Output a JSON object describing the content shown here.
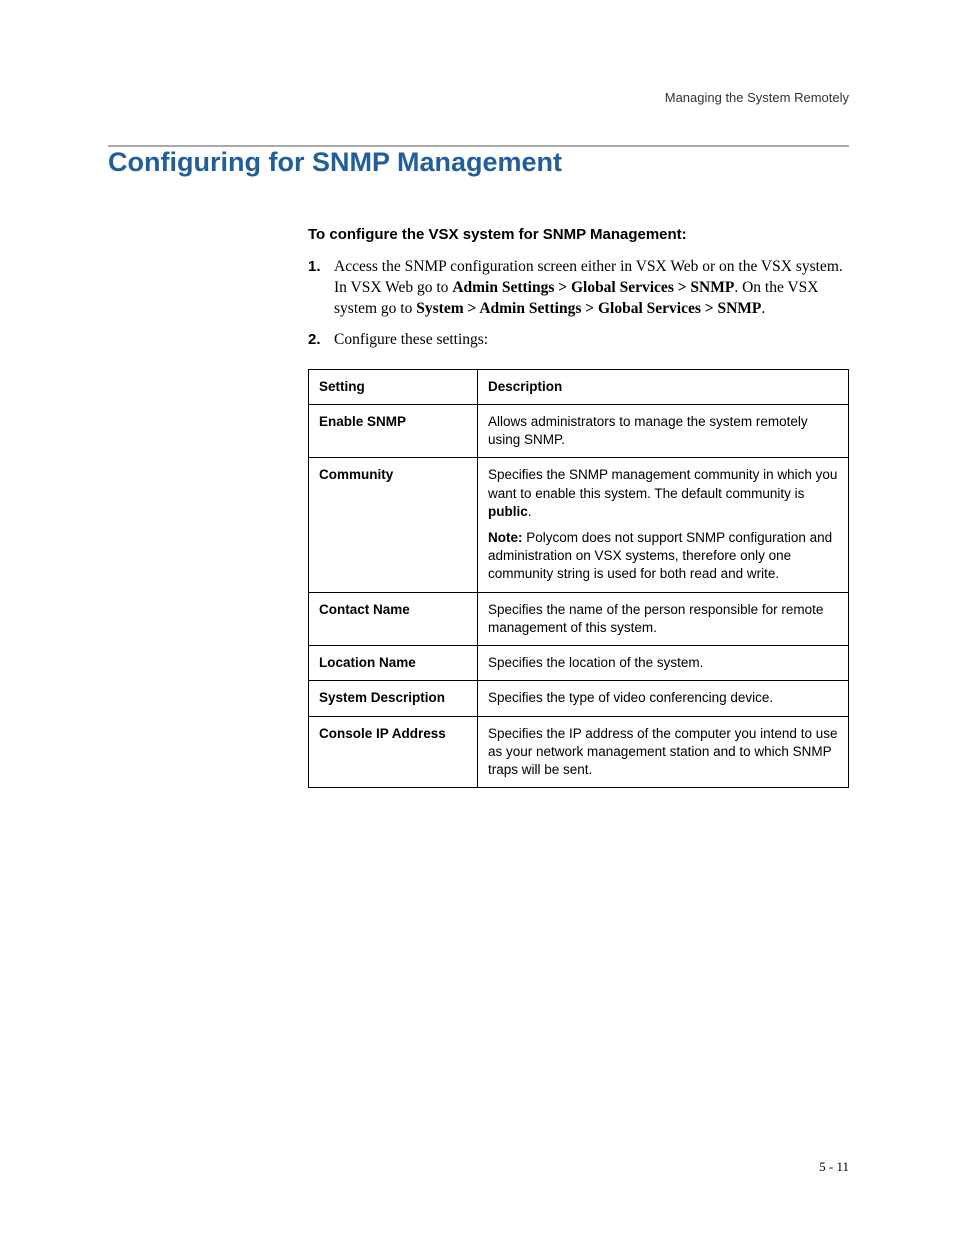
{
  "header": {
    "running_head": "Managing the System Remotely"
  },
  "section": {
    "title": "Configuring for SNMP Management",
    "procedure_title": "To configure the VSX system for SNMP Management:",
    "steps": [
      {
        "num": "1.",
        "text_pre": "Access the SNMP configuration screen either in VSX Web or on the VSX system. In VSX Web go to ",
        "bold1": "Admin Settings > Global Services > SNMP",
        "text_mid": ". On the VSX system go to ",
        "bold2": "System > Admin Settings > Global Services > SNMP",
        "text_post": "."
      },
      {
        "num": "2.",
        "text_pre": "Configure these settings:",
        "bold1": "",
        "text_mid": "",
        "bold2": "",
        "text_post": ""
      }
    ]
  },
  "table": {
    "head_setting": "Setting",
    "head_description": "Description",
    "rows": [
      {
        "setting": "Enable SNMP",
        "para1": "Allows administrators to manage the system remotely using SNMP.",
        "para2_note": "",
        "para2_bold": "",
        "para2_post": "",
        "para2_rest": ""
      },
      {
        "setting": "Community",
        "para1_pre": "Specifies the SNMP management community in which you want to enable this system. The default community is ",
        "para1_bold": "public",
        "para1_post": ".",
        "para2_note": "Note:",
        "para2_rest": " Polycom does not support SNMP configuration and administration on VSX systems, therefore only one community string is used for both read and write."
      },
      {
        "setting": "Contact Name",
        "para1": "Specifies the name of the person responsible for remote management of this system.",
        "para2_note": "",
        "para2_rest": ""
      },
      {
        "setting": "Location Name",
        "para1": "Specifies the location of the system.",
        "para2_note": "",
        "para2_rest": ""
      },
      {
        "setting": "System Description",
        "para1": "Specifies the type of video conferencing device.",
        "para2_note": "",
        "para2_rest": ""
      },
      {
        "setting": "Console IP Address",
        "para1": "Specifies the IP address of the computer you intend to use as your network management station and to which SNMP traps will be sent.",
        "para2_note": "",
        "para2_rest": ""
      }
    ]
  },
  "footer": {
    "page_number": "5 - 11"
  }
}
